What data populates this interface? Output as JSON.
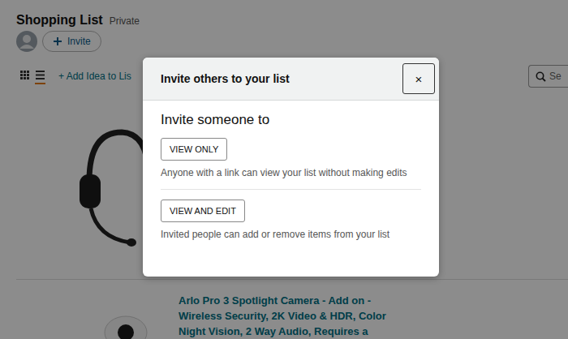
{
  "page": {
    "title": "Shopping List",
    "privacy": "Private",
    "invite_button": "Invite",
    "add_idea": "+ Add Idea to Lis",
    "search": {
      "placeholder": "Se"
    },
    "view_modes": [
      {
        "kind": "grid",
        "selected": false
      },
      {
        "kind": "list",
        "selected": true
      }
    ]
  },
  "items": [
    {
      "kind": "headset"
    },
    {
      "kind": "camera",
      "title": "Arlo Pro 3 Spotlight Camera - Add on - Wireless Security, 2K Video & HDR, Color Night Vision, 2 Way Audio, Requires a"
    }
  ],
  "dialog": {
    "title": "Invite others to your list",
    "close": "×",
    "heading": "Invite someone to",
    "options": [
      {
        "button": "VIEW ONLY",
        "description": "Anyone with a link can view your list without making edits"
      },
      {
        "button": "VIEW AND EDIT",
        "description": "Invited people can add or remove items from your list"
      }
    ]
  }
}
